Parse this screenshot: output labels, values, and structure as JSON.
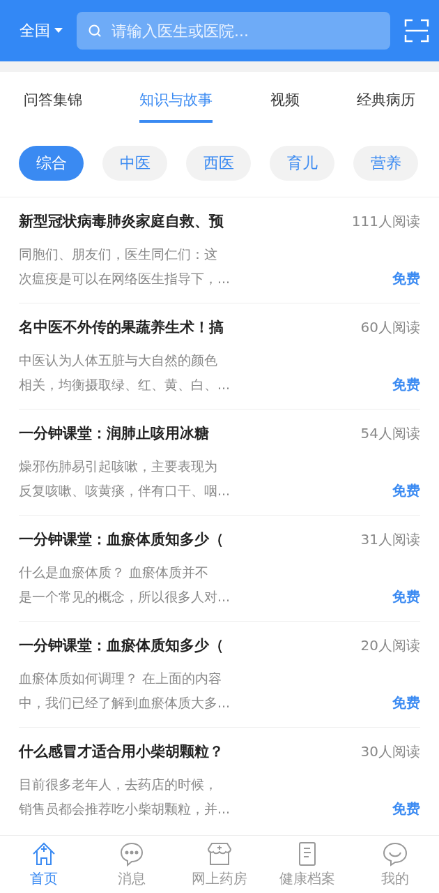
{
  "header": {
    "region": "全国",
    "search": {
      "placeholder": "请输入医生或医院..."
    }
  },
  "tabs": [
    {
      "label": "问答集锦",
      "selected": false
    },
    {
      "label": "知识与故事",
      "selected": true
    },
    {
      "label": "视频",
      "selected": false
    },
    {
      "label": "经典病历",
      "selected": false
    }
  ],
  "chips": [
    {
      "label": "综合",
      "selected": true
    },
    {
      "label": "中医",
      "selected": false
    },
    {
      "label": "西医",
      "selected": false
    },
    {
      "label": "育儿",
      "selected": false
    },
    {
      "label": "营养",
      "selected": false
    }
  ],
  "articles": [
    {
      "title": "新型冠状病毒肺炎家庭自救、预",
      "reads": "111人阅读",
      "desc_lines": [
        "同胞们、朋友们，医生同仁们：这",
        "次瘟疫是可以在网络医生指导下，..."
      ],
      "price": "免费"
    },
    {
      "title": "名中医不外传的果蔬养生术！搞",
      "reads": "60人阅读",
      "desc_lines": [
        "中医认为人体五脏与大自然的颜色",
        "相关，均衡摄取绿、红、黄、白、..."
      ],
      "price": "免费"
    },
    {
      "title": "一分钟课堂：润肺止咳用冰糖",
      "reads": "54人阅读",
      "desc_lines": [
        "燥邪伤肺易引起咳嗽，主要表现为",
        "反复咳嗽、咳黄痰，伴有口干、咽..."
      ],
      "price": "免费"
    },
    {
      "title": "一分钟课堂：血瘀体质知多少（",
      "reads": "31人阅读",
      "desc_lines": [
        "什么是血瘀体质？ 血瘀体质并不",
        "是一个常见的概念，所以很多人对..."
      ],
      "price": "免费"
    },
    {
      "title": "一分钟课堂：血瘀体质知多少（",
      "reads": "20人阅读",
      "desc_lines": [
        "血瘀体质如何调理？ 在上面的内容",
        "中，我们已经了解到血瘀体质大多..."
      ],
      "price": "免费"
    },
    {
      "title": "什么感冒才适合用小柴胡颗粒？",
      "reads": "30人阅读",
      "desc_lines": [
        "目前很多老年人，去药店的时候，",
        "销售员都会推荐吃小柴胡颗粒，并..."
      ],
      "price": "免费"
    }
  ],
  "bottom_nav": [
    {
      "kind": "home",
      "label": "首页",
      "selected": true
    },
    {
      "kind": "messages",
      "label": "消息",
      "selected": false
    },
    {
      "kind": "pharmacy",
      "label": "网上药房",
      "selected": false
    },
    {
      "kind": "records",
      "label": "健康档案",
      "selected": false
    },
    {
      "kind": "profile",
      "label": "我的",
      "selected": false
    }
  ]
}
